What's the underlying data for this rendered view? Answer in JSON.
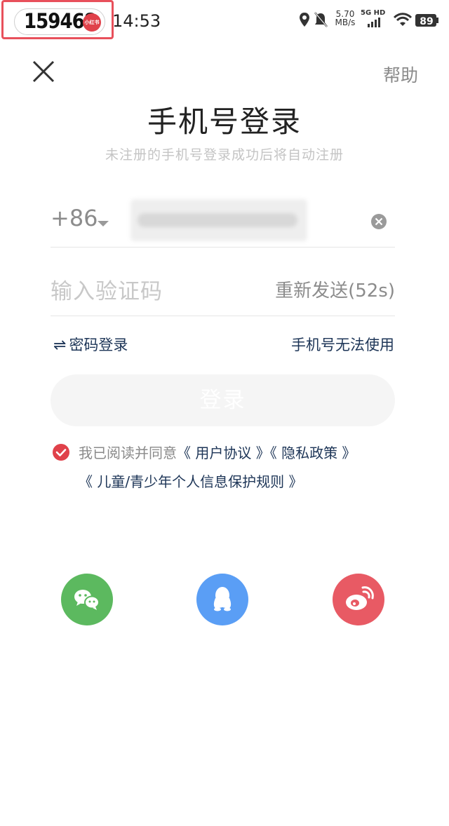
{
  "status_bar": {
    "badge_number": "159468",
    "badge_logo_text": "小红书",
    "time": "14:53",
    "net_speed_value": "5.70",
    "net_speed_unit": "MB/s",
    "network_label": "5G HD",
    "battery": "89"
  },
  "header": {
    "help_label": "帮助",
    "title": "手机号登录",
    "subtitle": "未注册的手机号登录成功后将自动注册"
  },
  "form": {
    "country_code": "+86",
    "code_placeholder": "输入验证码",
    "resend_label": "重新发送(52s)",
    "password_login_label": "密码登录",
    "phone_unavailable_label": "手机号无法使用",
    "login_button_label": "登录"
  },
  "agreement": {
    "prefix": "我已阅读并同意",
    "user_agreement": "《 用户协议 》",
    "privacy_policy": "《 隐私政策 》",
    "children_rules": "《 儿童/青少年个人信息保护规则 》"
  },
  "social_login": [
    {
      "icon": "wechat-icon",
      "color": "#5cb95f"
    },
    {
      "icon": "qq-icon",
      "color": "#5a9ef5"
    },
    {
      "icon": "weibo-icon",
      "color": "#e85a64"
    }
  ],
  "colors": {
    "accent_red": "#e0414a",
    "link_dark_blue": "#1d3557",
    "placeholder_gray": "#c8c8c8"
  }
}
